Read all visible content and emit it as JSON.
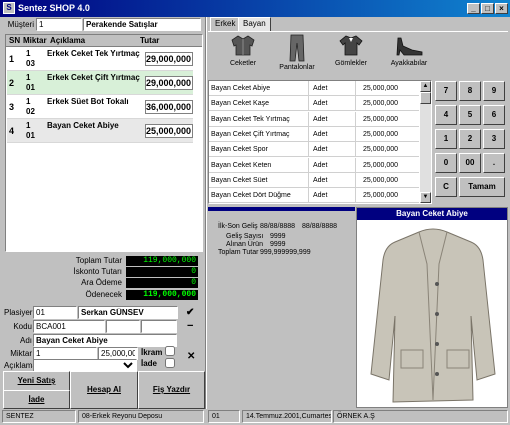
{
  "app": {
    "title": "Sentez SHOP  4.0"
  },
  "customer": {
    "label": "Müşteri",
    "code": "1",
    "name": "Perakende Satışlar"
  },
  "cart": {
    "columns": {
      "sn": "SN",
      "miktar": "Miktar",
      "aciklama": "Açıklama",
      "tutar": "Tutar"
    },
    "rows": [
      {
        "sn": "1",
        "miktar": "1",
        "code": "03",
        "aciklama": "Erkek Ceket Tek Yırtmaç",
        "tutar": "29,000,000"
      },
      {
        "sn": "2",
        "miktar": "1",
        "code": "01",
        "aciklama": "Erkek Ceket Çift Yırtmaç",
        "tutar": "29,000,000"
      },
      {
        "sn": "3",
        "miktar": "1",
        "code": "02",
        "aciklama": "Erkek Süet Bot Tokalı",
        "tutar": "36,000,000"
      },
      {
        "sn": "4",
        "miktar": "1",
        "code": "01",
        "aciklama": "Bayan Ceket Abiye",
        "tutar": "25,000,000"
      }
    ]
  },
  "totals": {
    "toplam_label": "Toplam Tutar",
    "toplam": "119,000,000",
    "iskonto_label": "İskonto Tutarı",
    "iskonto": "0",
    "ara_label": "Ara Ödeme",
    "ara": "0",
    "odenecek_label": "Ödenecek",
    "odenecek": "119,000,000"
  },
  "form": {
    "plasiyer_label": "Plasiyer",
    "plasiyer_code": "01",
    "plasiyer_name": "Serkan GÜNSEV",
    "kodu_label": "Kodu",
    "kodu": "BCA001",
    "adi_label": "Adı",
    "adi": "Bayan Ceket Abiye",
    "miktar_label": "Miktar",
    "miktar": "1",
    "fiyat": "25,000,000",
    "ikram_label": "İkram",
    "iade_label": "İade",
    "aciklama_label": "Açıklama",
    "aciklama": ""
  },
  "buttons": {
    "yeni_satis": "Yeni Satış",
    "iade": "İade",
    "hesap_al": "Hesap Al",
    "fis_yazdir": "Fiş Yazdır",
    "check": "✔",
    "minus": "−",
    "cross": "✕"
  },
  "tabs": [
    "Erkek",
    "Bayan"
  ],
  "categories": [
    "Ceketler",
    "Pantalonlar",
    "Gömlekler",
    "Ayakkabılar"
  ],
  "products": [
    {
      "name": "Bayan Ceket Abiye",
      "unit": "Adet",
      "price": "25,000,000"
    },
    {
      "name": "Bayan Ceket Kaşe",
      "unit": "Adet",
      "price": "25,000,000"
    },
    {
      "name": "Bayan Ceket Tek Yırtmaç",
      "unit": "Adet",
      "price": "25,000,000"
    },
    {
      "name": "Bayan Ceket Çift Yırtmaç",
      "unit": "Adet",
      "price": "25,000,000"
    },
    {
      "name": "Bayan Ceket Spor",
      "unit": "Adet",
      "price": "25,000,000"
    },
    {
      "name": "Bayan Ceket Keten",
      "unit": "Adet",
      "price": "25,000,000"
    },
    {
      "name": "Bayan Ceket Süet",
      "unit": "Adet",
      "price": "25,000,000"
    },
    {
      "name": "Bayan Ceket Dört Düğme",
      "unit": "Adet",
      "price": "25,000,000"
    }
  ],
  "keypad": [
    "7",
    "8",
    "9",
    "4",
    "5",
    "6",
    "1",
    "2",
    "3",
    "0",
    "00",
    ".",
    "C",
    "Tamam"
  ],
  "info": {
    "ilk_son_label": "İlk-Son Geliş",
    "ilk": "88/88/8888",
    "son": "88/88/8888",
    "gelis_label": "Geliş Sayısı",
    "gelis": "9999",
    "alinan_label": "Alınan Ürün",
    "alinan": "9999",
    "toplam_label": "Toplam Tutar",
    "toplam": "999,999999,999"
  },
  "preview": {
    "title": "Bayan Ceket Abiye"
  },
  "status": {
    "company": "SENTEZ",
    "depot": "08-Erkek Reyonu Deposu",
    "cashier": "01",
    "date": "14.Temmuz.2001,Cumartesi",
    "owner": "ÖRNEK A.Ş"
  }
}
